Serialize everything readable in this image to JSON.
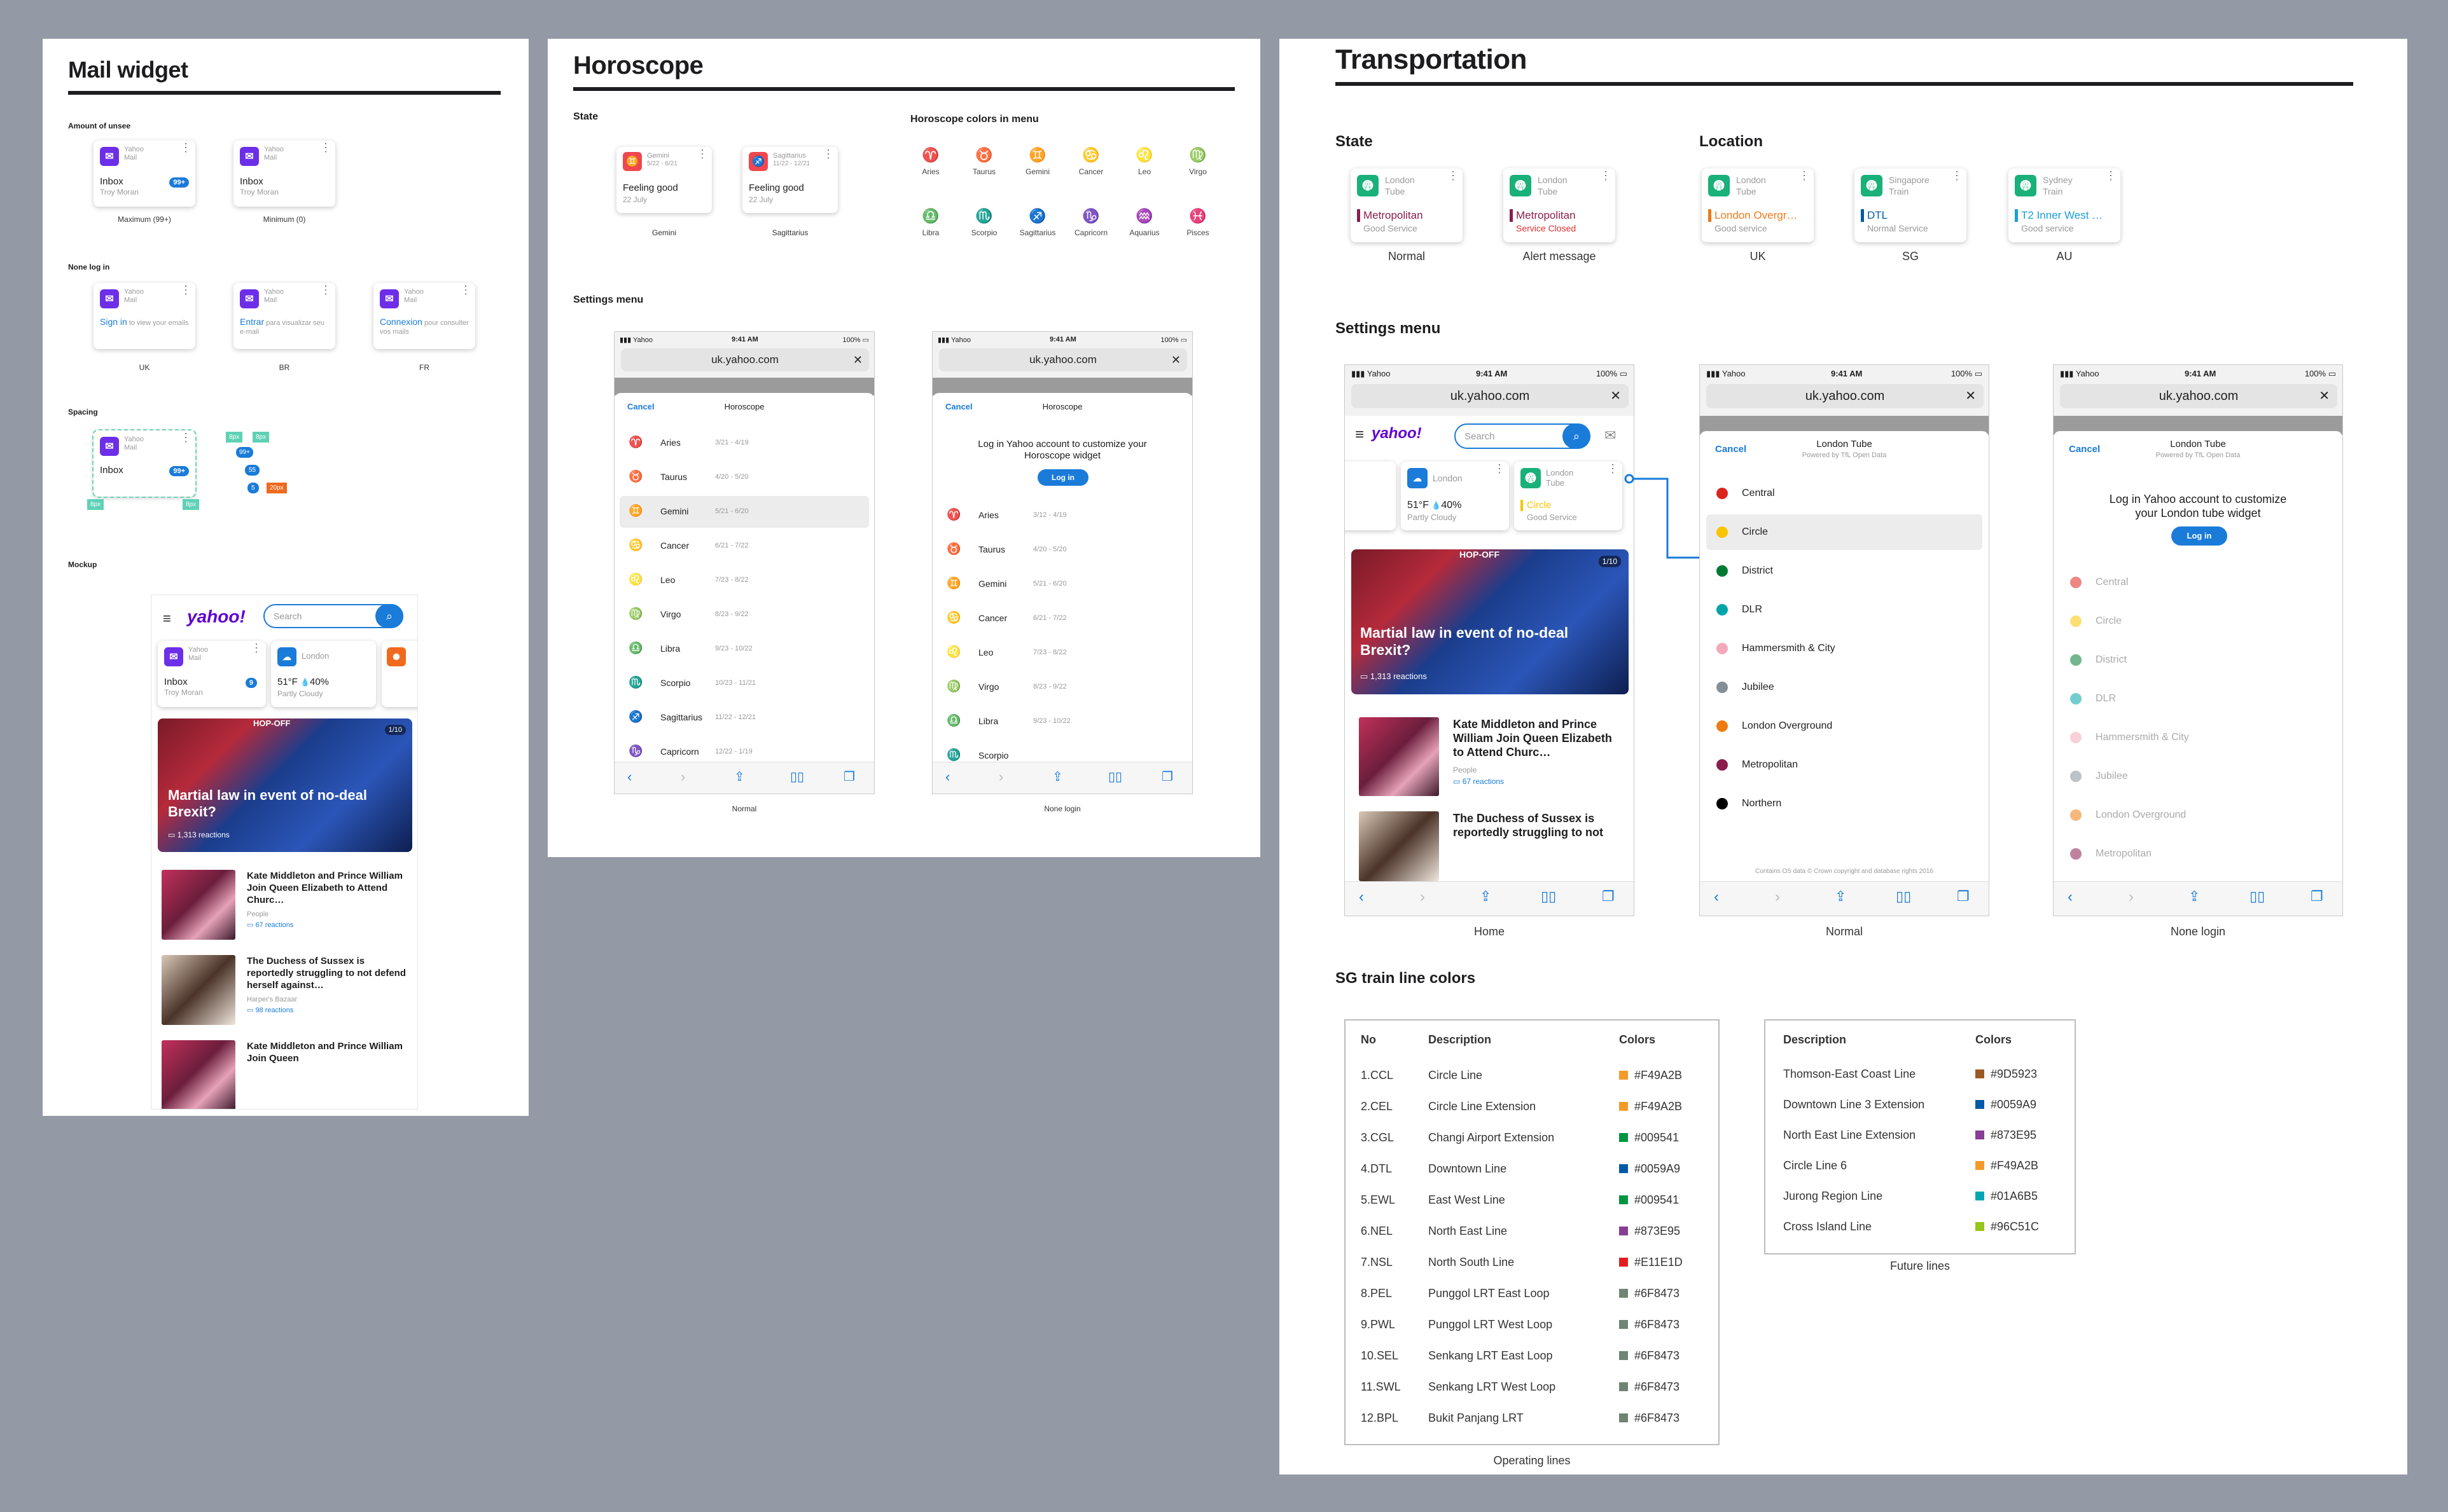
{
  "mail": {
    "title": "Mail widget",
    "s_amount": "Amount of unsee",
    "s_none": "None log in",
    "s_spacing": "Spacing",
    "s_mockup": "Mockup",
    "app": "Yahoo",
    "app2": "Mail",
    "inbox": "Inbox",
    "user": "Troy Moran",
    "badge_max": "99+",
    "badge_min": "9",
    "cap_max": "Maximum (99+)",
    "cap_min": "Minimum (0)",
    "uk_link": "Sign in",
    "uk_rest": "to view your emails",
    "br_link": "Entrar",
    "br_rest": "para visualizar seu e-mail",
    "fr_link": "Connexion",
    "fr_rest": "pour consulter vos mails",
    "cap_uk": "UK",
    "cap_br": "BR",
    "cap_fr": "FR",
    "sp1": "8px",
    "sp2": "8px",
    "sp3": "99+",
    "sp4": "55",
    "sp5": "5",
    "sp6": "20px",
    "sp7": "8px",
    "sp8": "8px"
  },
  "mock": {
    "logo": "yahoo!",
    "search": "Search",
    "weather_city": "London",
    "temp": "51°F",
    "rain": "40%",
    "cond": "Partly Cloudy",
    "tag": "HOP-OFF",
    "counter": "1/10",
    "headline": "Martial law in event of no-deal Brexit?",
    "reactions": "1,313 reactions",
    "s1_title": "Kate Middleton and Prince William Join Queen Elizabeth to Attend Churc…",
    "s1_src": "People",
    "s1_re": "67 reactions",
    "s2_title": "The Duchess of Sussex is reportedly struggling to not defend herself against…",
    "s2_src": "Harper's Bazaar",
    "s2_re": "98 reactions",
    "s3_title": "Kate Middleton and Prince William Join Queen"
  },
  "horo": {
    "title": "Horoscope",
    "s_state": "State",
    "s_colors": "Horoscope colors in menu",
    "s_settings": "Settings menu",
    "g_name": "Gemini",
    "g_dates": "5/22 - 6/21",
    "s_name": "Sagittarius",
    "s_dates": "11/22 - 12/21",
    "feel": "Feeling good",
    "date": "22 July",
    "cap_g": "Gemini",
    "cap_s": "Sagittarius",
    "signs": [
      "Aries",
      "Taurus",
      "Gemini",
      "Cancer",
      "Leo",
      "Virgo",
      "Libra",
      "Scorpio",
      "Sagittarius",
      "Capricorn",
      "Aquarius",
      "Pisces"
    ],
    "sign_colors": [
      "#1fb87a",
      "#2db36a",
      "#4aa3e0",
      "#2f6ed9",
      "#3a4bd1",
      "#8a3ad8",
      "#7b3fcf",
      "#c83aa8",
      "#e0407a",
      "#f2613f",
      "#f58a1f",
      "#f2a400"
    ],
    "menu": [
      {
        "n": "Aries",
        "d": "3/21 - 4/19"
      },
      {
        "n": "Taurus",
        "d": "4/20 - 5/20"
      },
      {
        "n": "Gemini",
        "d": "5/21 - 6/20"
      },
      {
        "n": "Cancer",
        "d": "6/21 - 7/22"
      },
      {
        "n": "Leo",
        "d": "7/23 - 8/22"
      },
      {
        "n": "Virgo",
        "d": "8/23 - 9/22"
      },
      {
        "n": "Libra",
        "d": "9/23 - 10/22"
      },
      {
        "n": "Scorpio",
        "d": "10/23 - 11/21"
      },
      {
        "n": "Sagittarius",
        "d": "11/22 - 12/21"
      },
      {
        "n": "Capricorn",
        "d": "12/22 - 1/19"
      }
    ],
    "menu2": [
      {
        "n": "Aries",
        "d": "3/12 - 4/19"
      },
      {
        "n": "Taurus",
        "d": "4/20 - 5/20"
      },
      {
        "n": "Gemini",
        "d": "5/21 - 6/20"
      },
      {
        "n": "Cancer",
        "d": "6/21 - 7/22"
      },
      {
        "n": "Leo",
        "d": "7/23 - 8/22"
      },
      {
        "n": "Virgo",
        "d": "8/23 - 9/22"
      },
      {
        "n": "Libra",
        "d": "9/23 - 10/22"
      },
      {
        "n": "Scorpio",
        "d": ""
      }
    ],
    "cancel": "Cancel",
    "header": "Horoscope",
    "login_text": "Log in Yahoo account to customize your Horoscope widget",
    "login_btn": "Log in",
    "cap_normal": "Normal",
    "cap_none": "None login"
  },
  "phone": {
    "carrier": "Yahoo",
    "time": "9:41 AM",
    "battery": "100%",
    "url": "uk.yahoo.com"
  },
  "trans": {
    "title": "Transportation",
    "s_state": "State",
    "s_location": "Location",
    "s_settings": "Settings menu",
    "s_sg": "SG train line colors",
    "cards": [
      {
        "a": "London",
        "b": "Tube",
        "line": "Metropolitan",
        "status": "Good Service",
        "cap": "Normal",
        "lc": "#8a1e4d",
        "alert": false
      },
      {
        "a": "London",
        "b": "Tube",
        "line": "Metropolitan",
        "status": "Service Closed",
        "cap": "Alert message",
        "lc": "#8a1e4d",
        "alert": true
      },
      {
        "a": "London",
        "b": "Tube",
        "line": "London Overgr…",
        "status": "Good service",
        "cap": "UK",
        "lc": "#f07a1a",
        "alert": false
      },
      {
        "a": "Singapore",
        "b": "Train",
        "line": "DTL",
        "status": "Normal Service",
        "cap": "SG",
        "lc": "#0059a9",
        "alert": false
      },
      {
        "a": "Sydney",
        "b": "Train",
        "line": "T2 Inner West …",
        "status": "Good service",
        "cap": "AU",
        "lc": "#1aa0d8",
        "alert": false
      }
    ],
    "home_cap": "Home",
    "normal_cap": "Normal",
    "none_cap": "None login",
    "cancel": "Cancel",
    "header": "London Tube",
    "powered": "Powered by TfL Open Data",
    "tube": [
      {
        "n": "Central",
        "c": "#dc241f"
      },
      {
        "n": "Circle",
        "c": "#f8c500"
      },
      {
        "n": "District",
        "c": "#007a33"
      },
      {
        "n": "DLR",
        "c": "#00a4a7"
      },
      {
        "n": "Hammersmith & City",
        "c": "#f3a9bb"
      },
      {
        "n": "Jubilee",
        "c": "#868f98"
      },
      {
        "n": "London Overground",
        "c": "#ef7b10"
      },
      {
        "n": "Metropolitan",
        "c": "#8a1e4d"
      },
      {
        "n": "Northern",
        "c": "#000000"
      }
    ],
    "footnote": "Contains OS data © Crown copyright and database rights 2016",
    "login_text": "Log in Yahoo account to customize your London tube widget",
    "login_btn": "Log in",
    "home_weather": "London",
    "home_temp": "51°F",
    "home_rain": "40%",
    "home_cond": "Partly Cloudy",
    "home_line": "Circle",
    "home_status": "Good Service",
    "home_s1": "Kate Middleton and Prince William Join Queen Elizabeth to Attend Churc…",
    "home_s1_src": "People",
    "home_s1_re": "67 reactions",
    "home_s2": "The Duchess of Sussex is reportedly struggling to not",
    "op_head": [
      "No",
      "Description",
      "Colors"
    ],
    "op": [
      [
        "1.CCL",
        "Circle Line",
        "#F49A2B"
      ],
      [
        "2.CEL",
        "Circle Line Extension",
        "#F49A2B"
      ],
      [
        "3.CGL",
        "Changi Airport Extension",
        "#009541"
      ],
      [
        "4.DTL",
        "Downtown Line",
        "#0059A9"
      ],
      [
        "5.EWL",
        "East West Line",
        "#009541"
      ],
      [
        "6.NEL",
        "North East Line",
        "#873E95"
      ],
      [
        "7.NSL",
        "North South Line",
        "#E11E1D"
      ],
      [
        "8.PEL",
        "Punggol LRT East Loop",
        "#6F8473"
      ],
      [
        "9.PWL",
        "Punggol LRT West Loop",
        "#6F8473"
      ],
      [
        "10.SEL",
        "Senkang LRT East Loop",
        "#6F8473"
      ],
      [
        "11.SWL",
        "Senkang LRT West Loop",
        "#6F8473"
      ],
      [
        "12.BPL",
        "Bukit Panjang LRT",
        "#6F8473"
      ]
    ],
    "op_cap": "Operating lines",
    "fu_head": [
      "Description",
      "Colors"
    ],
    "fu": [
      [
        "Thomson-East Coast Line",
        "#9D5923"
      ],
      [
        "Downtown Line 3 Extension",
        "#0059A9"
      ],
      [
        "North East Line Extension",
        "#873E95"
      ],
      [
        "Circle Line 6",
        "#F49A2B"
      ],
      [
        "Jurong Region Line",
        "#01A6B5"
      ],
      [
        "Cross Island Line",
        "#96C51C"
      ]
    ],
    "fu_cap": "Future lines"
  }
}
